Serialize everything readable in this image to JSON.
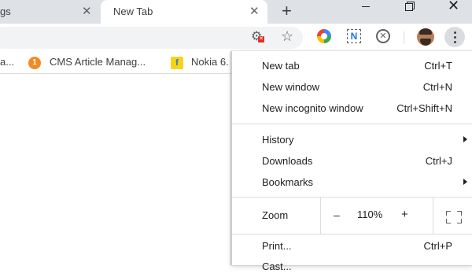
{
  "tabs": {
    "prev_label": "gs",
    "active_label": "New Tab",
    "close_glyph": "✕",
    "new_tab_glyph": "+"
  },
  "toolbar": {
    "icons": [
      "blocked-content-icon",
      "bookmark-star-icon",
      "extension-color-icon",
      "extension-n-icon",
      "extension-x-icon",
      "profile-avatar",
      "more-menu-icon"
    ],
    "ext2_text": "N",
    "ext3_text": "✕",
    "star_glyph": "☆",
    "blocked_glyph": "⚙",
    "blocked_badge": "✕"
  },
  "bookmarks": {
    "item1": "a...",
    "item2": "CMS Article Manag...",
    "item2_badge": "1",
    "item3": "Nokia 6.",
    "item3_badge": "f"
  },
  "menu": {
    "new_tab": {
      "label": "New tab",
      "shortcut": "Ctrl+T"
    },
    "new_window": {
      "label": "New window",
      "shortcut": "Ctrl+N"
    },
    "new_incognito": {
      "label": "New incognito window",
      "shortcut": "Ctrl+Shift+N"
    },
    "history": {
      "label": "History"
    },
    "downloads": {
      "label": "Downloads",
      "shortcut": "Ctrl+J"
    },
    "bookmarks": {
      "label": "Bookmarks"
    },
    "zoom": {
      "label": "Zoom",
      "minus": "–",
      "value": "110%",
      "plus": "+"
    },
    "print": {
      "label": "Print...",
      "shortcut": "Ctrl+P"
    },
    "cast": {
      "label": "Cast..."
    }
  },
  "colors": {
    "tabstrip": "#dee1e6",
    "accent": "#1a73e8"
  }
}
